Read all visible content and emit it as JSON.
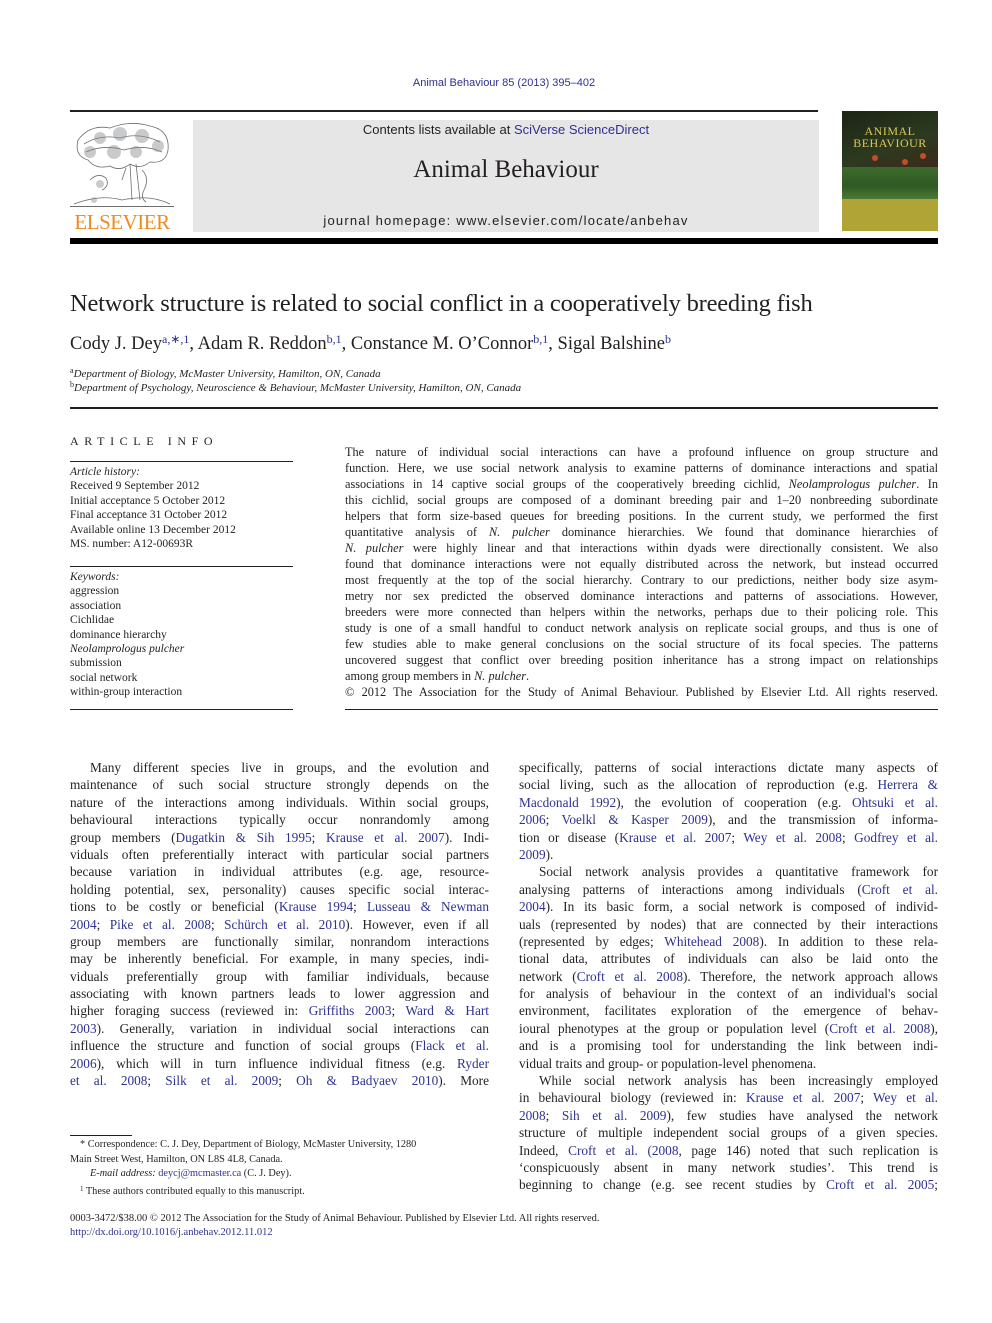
{
  "header": {
    "citation": "Animal Behaviour 85 (2013) 395–402",
    "contents_prefix": "Contents lists available at ",
    "contents_link": "SciVerse ScienceDirect",
    "journal_name": "Animal Behaviour",
    "homepage": "journal homepage: www.elsevier.com/locate/anbehav",
    "publisher_logo_text": "ELSEVIER",
    "cover_title_line1": "ANIMAL",
    "cover_title_line2": "BEHAVIOUR"
  },
  "colors": {
    "link": "#2e3192",
    "elsevier_orange": "#f18a21",
    "masthead_bg": "#e6e6e6",
    "text": "#231f20"
  },
  "article": {
    "title": "Network structure is related to social conflict in a cooperatively breeding fish",
    "authors": [
      {
        "name": "Cody J. Dey",
        "sup": "a,∗,1"
      },
      {
        "name": "Adam R. Reddon",
        "sup": "b,1"
      },
      {
        "name": "Constance M. O’Connor",
        "sup": "b,1"
      },
      {
        "name": "Sigal Balshine",
        "sup": "b"
      }
    ],
    "affiliations": [
      {
        "key": "a",
        "text": "Department of Biology, McMaster University, Hamilton, ON, Canada"
      },
      {
        "key": "b",
        "text": "Department of Psychology, Neuroscience & Behaviour, McMaster University, Hamilton, ON, Canada"
      }
    ]
  },
  "article_info": {
    "heading": "ARTICLE INFO",
    "history_label": "Article history:",
    "history": [
      "Received 9 September 2012",
      "Initial acceptance 5 October 2012",
      "Final acceptance 31 October 2012",
      "Available online 13 December 2012",
      "MS. number: A12-00693R"
    ],
    "keywords_label": "Keywords:",
    "keywords": [
      "aggression",
      "association",
      "Cichlidae",
      "dominance hierarchy",
      "Neolamprologus pulcher",
      "submission",
      "social network",
      "within-group interaction"
    ]
  },
  "abstract": {
    "lines": [
      [
        {
          "t": "The nature of individual social interactions can have a profound influence on group structure and"
        }
      ],
      [
        {
          "t": "function. Here, we use social network analysis to examine patterns of dominance interactions and spatial"
        }
      ],
      [
        {
          "t": "associations in 14 captive social groups of the cooperatively breeding cichlid, "
        },
        {
          "t": "Neolamprologus pulcher",
          "i": true
        },
        {
          "t": ". In"
        }
      ],
      [
        {
          "t": "this cichlid, social groups are composed of a dominant breeding pair and 1–20 nonbreeding subordinate"
        }
      ],
      [
        {
          "t": "helpers that form size-based queues for breeding positions. In the current study, we performed the first"
        }
      ],
      [
        {
          "t": "quantitative analysis of "
        },
        {
          "t": "N. pulcher",
          "i": true
        },
        {
          "t": " dominance hierarchies. We found that dominance hierarchies of"
        }
      ],
      [
        {
          "t": "N. pulcher",
          "i": true
        },
        {
          "t": " were highly linear and that interactions within dyads were directionally consistent. We also"
        }
      ],
      [
        {
          "t": "found that dominance interactions were not equally distributed across the network, but instead occurred"
        }
      ],
      [
        {
          "t": "most frequently at the top of the social hierarchy. Contrary to our predictions, neither body size asym-"
        }
      ],
      [
        {
          "t": "metry nor sex predicted the observed dominance interactions and patterns of associations. However,"
        }
      ],
      [
        {
          "t": "breeders were more connected than helpers within the networks, perhaps due to their policing role. This"
        }
      ],
      [
        {
          "t": "study is one of a small handful to conduct network analysis on replicate social groups, and thus is one of"
        }
      ],
      [
        {
          "t": "few studies able to make general conclusions on the social structure of its focal species. The patterns"
        }
      ],
      [
        {
          "t": "uncovered suggest that conflict over breeding position inheritance has a strong impact on relationships"
        }
      ],
      [
        {
          "t": "among group members in "
        },
        {
          "t": "N. pulcher",
          "i": true
        },
        {
          "t": "."
        }
      ]
    ],
    "copyright": "© 2012 The Association for the Study of Animal Behaviour. Published by Elsevier Ltd. All rights reserved."
  },
  "body_left": {
    "lines": [
      [
        {
          "t": "Many different species live in groups, and the evolution and"
        }
      ],
      [
        {
          "t": "maintenance of such social structure strongly depends on the"
        }
      ],
      [
        {
          "t": "nature of the interactions among individuals. Within social groups,"
        }
      ],
      [
        {
          "t": "behavioural interactions typically occur nonrandomly among"
        }
      ],
      [
        {
          "t": "group members ("
        },
        {
          "t": "Dugatkin & Sih 1995",
          "l": true
        },
        {
          "t": "; "
        },
        {
          "t": "Krause et al. 2007",
          "l": true
        },
        {
          "t": "). Indi-"
        }
      ],
      [
        {
          "t": "viduals often preferentially interact with particular social partners"
        }
      ],
      [
        {
          "t": "because variation in individual attributes (e.g. age, resource-"
        }
      ],
      [
        {
          "t": "holding potential, sex, personality) causes specific social interac-"
        }
      ],
      [
        {
          "t": "tions to be costly or beneficial ("
        },
        {
          "t": "Krause 1994",
          "l": true
        },
        {
          "t": "; "
        },
        {
          "t": "Lusseau & Newman",
          "l": true
        }
      ],
      [
        {
          "t": "2004",
          "l": true
        },
        {
          "t": "; "
        },
        {
          "t": "Pike et al. 2008",
          "l": true
        },
        {
          "t": "; "
        },
        {
          "t": "Schürch et al. 2010",
          "l": true
        },
        {
          "t": "). However, even if all"
        }
      ],
      [
        {
          "t": "group members are functionally similar, nonrandom interactions"
        }
      ],
      [
        {
          "t": "may be inherently beneficial. For example, in many species, indi-"
        }
      ],
      [
        {
          "t": "viduals preferentially group with familiar individuals, because"
        }
      ],
      [
        {
          "t": "associating with known partners leads to lower aggression and"
        }
      ],
      [
        {
          "t": "higher foraging success (reviewed in: "
        },
        {
          "t": "Griffiths 2003",
          "l": true
        },
        {
          "t": "; "
        },
        {
          "t": "Ward & Hart",
          "l": true
        }
      ],
      [
        {
          "t": "2003",
          "l": true
        },
        {
          "t": "). Generally, variation in individual social interactions can"
        }
      ],
      [
        {
          "t": "influence the structure and function of social groups ("
        },
        {
          "t": "Flack et al.",
          "l": true
        }
      ],
      [
        {
          "t": "2006",
          "l": true
        },
        {
          "t": "), which will in turn influence individual fitness (e.g. "
        },
        {
          "t": "Ryder",
          "l": true
        }
      ],
      [
        {
          "t": "et al. 2008",
          "l": true
        },
        {
          "t": "; "
        },
        {
          "t": "Silk et al. 2009",
          "l": true
        },
        {
          "t": "; "
        },
        {
          "t": "Oh & Badyaev 2010",
          "l": true
        },
        {
          "t": "). More"
        }
      ]
    ]
  },
  "body_right": {
    "lines": [
      [
        {
          "t": "specifically, patterns of social interactions dictate many aspects of"
        }
      ],
      [
        {
          "t": "social living, such as the allocation of reproduction (e.g. "
        },
        {
          "t": "Herrera &",
          "l": true
        }
      ],
      [
        {
          "t": "Macdonald 1992",
          "l": true
        },
        {
          "t": "), the evolution of cooperation (e.g. "
        },
        {
          "t": "Ohtsuki et al.",
          "l": true
        }
      ],
      [
        {
          "t": "2006",
          "l": true
        },
        {
          "t": "; "
        },
        {
          "t": "Voelkl & Kasper 2009",
          "l": true
        },
        {
          "t": "), and the transmission of informa-"
        }
      ],
      [
        {
          "t": "tion or disease ("
        },
        {
          "t": "Krause et al. 2007",
          "l": true
        },
        {
          "t": "; "
        },
        {
          "t": "Wey et al. 2008",
          "l": true
        },
        {
          "t": "; "
        },
        {
          "t": "Godfrey et al.",
          "l": true
        }
      ],
      [
        {
          "t": "2009",
          "l": true
        },
        {
          "t": ")."
        }
      ],
      [
        {
          "t": "Social network analysis provides a quantitative framework for"
        }
      ],
      [
        {
          "t": "analysing patterns of interactions among individuals ("
        },
        {
          "t": "Croft et al.",
          "l": true
        }
      ],
      [
        {
          "t": "2004",
          "l": true
        },
        {
          "t": "). In its basic form, a social network is composed of individ-"
        }
      ],
      [
        {
          "t": "uals (represented by nodes) that are connected by their interactions"
        }
      ],
      [
        {
          "t": "(represented by edges; "
        },
        {
          "t": "Whitehead 2008",
          "l": true
        },
        {
          "t": "). In addition to these rela-"
        }
      ],
      [
        {
          "t": "tional data, attributes of individuals can also be laid onto the"
        }
      ],
      [
        {
          "t": "network ("
        },
        {
          "t": "Croft et al. 2008",
          "l": true
        },
        {
          "t": "). Therefore, the network approach allows"
        }
      ],
      [
        {
          "t": "for analysis of behaviour in the context of an individual's social"
        }
      ],
      [
        {
          "t": "environment, facilitates exploration of the emergence of behav-"
        }
      ],
      [
        {
          "t": "ioural phenotypes at the group or population level ("
        },
        {
          "t": "Croft et al. 2008",
          "l": true
        },
        {
          "t": "),"
        }
      ],
      [
        {
          "t": "and is a promising tool for understanding the link between indi-"
        }
      ],
      [
        {
          "t": "vidual traits and group- or population-level phenomena."
        }
      ],
      [
        {
          "t": "While social network analysis has been increasingly employed"
        }
      ],
      [
        {
          "t": "in behavioural biology (reviewed in: "
        },
        {
          "t": "Krause et al. 2007",
          "l": true
        },
        {
          "t": "; "
        },
        {
          "t": "Wey et al.",
          "l": true
        }
      ],
      [
        {
          "t": "2008",
          "l": true
        },
        {
          "t": "; "
        },
        {
          "t": "Sih et al. 2009",
          "l": true
        },
        {
          "t": "), few studies have analysed the network"
        }
      ],
      [
        {
          "t": "structure of multiple independent social groups of a given species."
        }
      ],
      [
        {
          "t": "Indeed, "
        },
        {
          "t": "Croft et al. (2008",
          "l": true
        },
        {
          "t": ", page 146) noted that such replication is"
        }
      ],
      [
        {
          "t": "‘conspicuously absent in many network studies’. This trend is"
        }
      ],
      [
        {
          "t": "beginning to change (e.g. see recent studies by "
        },
        {
          "t": "Croft et al. 2005",
          "l": true
        },
        {
          "t": ";"
        }
      ]
    ],
    "indent_lines": [
      6,
      18
    ],
    "last_lines": [
      5,
      17
    ]
  },
  "footnotes": {
    "correspondence_mark": "*",
    "correspondence": "Correspondence: C. J. Dey, Department of Biology, McMaster University, 1280",
    "correspondence_cont": "Main Street West, Hamilton, ON L8S 4L8, Canada.",
    "email_label": "E-mail address: ",
    "email": "deycj@mcmaster.ca",
    "email_suffix": " (C. J. Dey).",
    "note1_mark": "1",
    "note1": "These authors contributed equally to this manuscript."
  },
  "bottom": {
    "issn_line": "0003-3472/$38.00 © 2012 The Association for the Study of Animal Behaviour. Published by Elsevier Ltd. All rights reserved.",
    "doi": "http://dx.doi.org/10.1016/j.anbehav.2012.11.012"
  }
}
